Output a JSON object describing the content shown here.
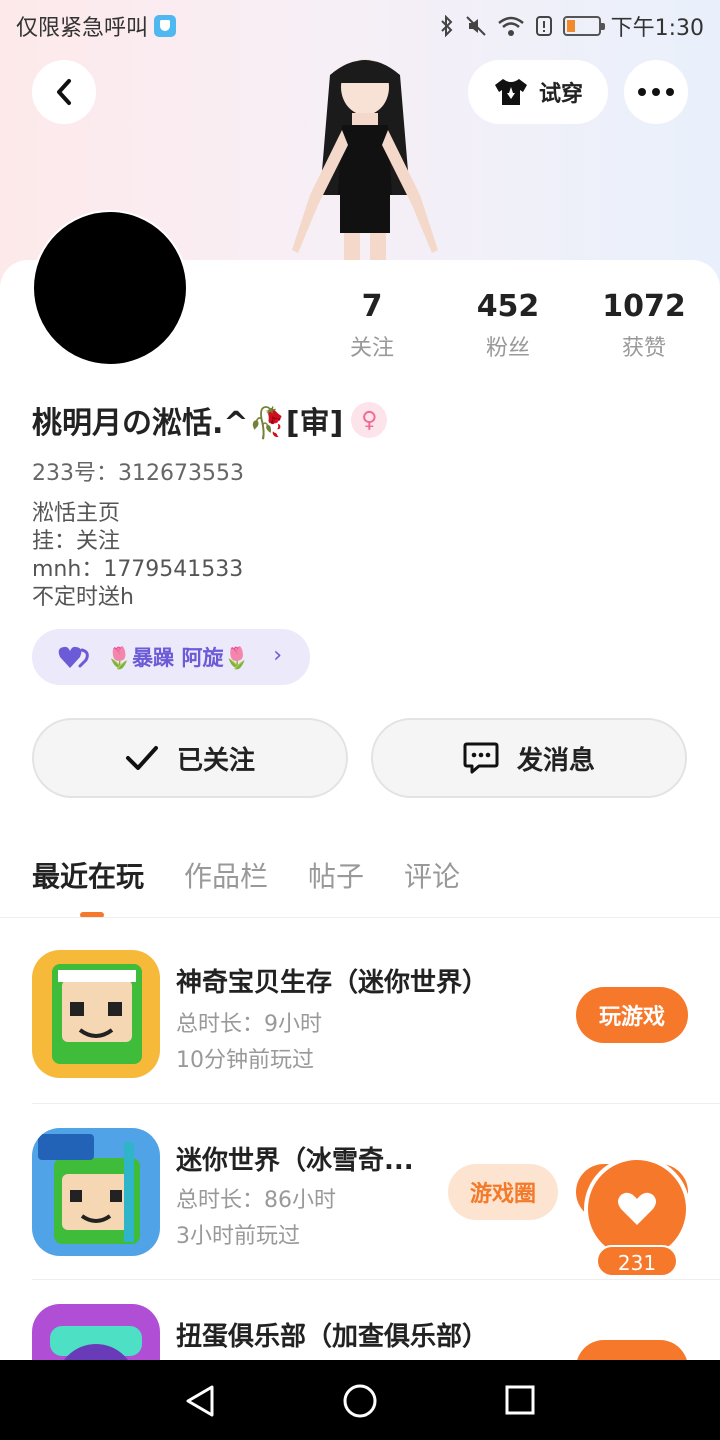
{
  "status_bar": {
    "carrier_text": "仅限紧急呼叫",
    "time": "下午1:30"
  },
  "header": {
    "try_on_label": "试穿"
  },
  "stats": [
    {
      "num": "7",
      "label": "关注"
    },
    {
      "num": "452",
      "label": "粉丝"
    },
    {
      "num": "1072",
      "label": "获赞"
    }
  ],
  "profile": {
    "name": "桃明月の淞恬.^🥀[审]",
    "uid": "233号：312673553",
    "bio": [
      "淞恬主页",
      "挂：关注",
      "mnh：1779541533",
      "不定时送h"
    ],
    "guild": "🌷暴躁 阿旋🌷"
  },
  "actions": {
    "followed_label": "已关注",
    "message_label": "发消息"
  },
  "tabs": [
    "最近在玩",
    "作品栏",
    "帖子",
    "评论"
  ],
  "games": [
    {
      "title": "神奇宝贝生存（迷你世界）",
      "duration": "总时长：9小时",
      "last_played": "10分钟前玩过",
      "button": "玩游戏"
    },
    {
      "title": "迷你世界（冰雪奇...",
      "duration": "总时长：86小时",
      "last_played": "3小时前玩过",
      "circle_button": "游戏圈"
    },
    {
      "title": "扭蛋俱乐部（加查俱乐部）"
    }
  ],
  "like_count": "231",
  "colors": {
    "accent": "#f6782a",
    "guild": "#6b5bd6"
  }
}
